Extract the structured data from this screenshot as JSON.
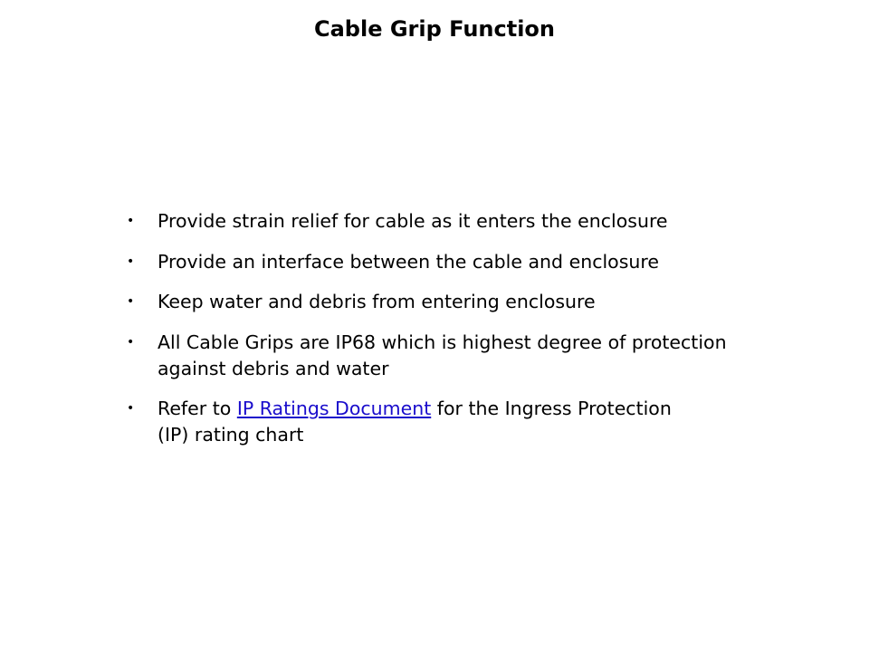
{
  "slide": {
    "title": "Cable Grip Function",
    "bullets": [
      {
        "text": "Provide strain relief for cable as it enters the enclosure"
      },
      {
        "text": "Provide an interface between the cable and enclosure"
      },
      {
        "text": "Keep water and debris from entering enclosure"
      },
      {
        "text": "All Cable Grips are IP68 which is highest degree of protection against debris and water"
      },
      {
        "prefix": "Refer to ",
        "link_text": "IP Ratings Document",
        "suffix": " for the Ingress Protection (IP) rating chart"
      }
    ],
    "bullet_glyph": "•",
    "colors": {
      "text": "#000000",
      "link": "#1a0dcc",
      "background": "#ffffff"
    }
  }
}
